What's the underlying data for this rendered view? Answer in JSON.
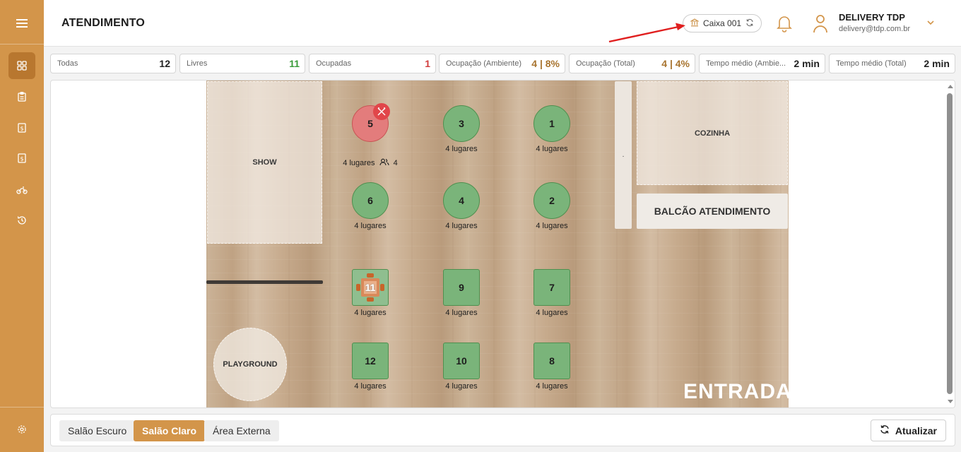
{
  "header": {
    "title": "ATENDIMENTO",
    "caixa_label": "Caixa 001",
    "user_name": "DELIVERY TDP",
    "user_email": "delivery@tdp.com.br"
  },
  "sidebar": {
    "items": [
      {
        "icon": "menu-icon"
      },
      {
        "icon": "grid-icon",
        "active": true
      },
      {
        "icon": "clipboard-icon"
      },
      {
        "icon": "cash-register-icon"
      },
      {
        "icon": "receipt-icon"
      },
      {
        "icon": "motorcycle-icon"
      },
      {
        "icon": "history-icon"
      },
      {
        "icon": "gear-icon"
      }
    ]
  },
  "stats": [
    {
      "label": "Todas",
      "value": "12",
      "color": "#222222"
    },
    {
      "label": "Livres",
      "value": "11",
      "color": "#3a9c3a"
    },
    {
      "label": "Ocupadas",
      "value": "1",
      "color": "#d13c3c"
    },
    {
      "label": "Ocupação (Ambiente)",
      "value": "4 | 8%",
      "color": "#a8742f"
    },
    {
      "label": "Ocupação (Total)",
      "value": "4 | 4%",
      "color": "#a8742f"
    },
    {
      "label": "Tempo médio (Ambie...",
      "value": "2 min",
      "color": "#222222"
    },
    {
      "label": "Tempo médio (Total)",
      "value": "2 min",
      "color": "#222222"
    }
  ],
  "floor": {
    "zones": {
      "show": "SHOW",
      "cozinha": "COZINHA",
      "balcao": "BALCÃO ATENDIMENTO",
      "playground": "PLAYGROUND",
      "entrada": "ENTRADA",
      "pillar_dot": "."
    },
    "tables": [
      {
        "number": "5",
        "seats": "4 lugares",
        "guests": "4",
        "status": "busy"
      },
      {
        "number": "3",
        "seats": "4 lugares",
        "status": "free"
      },
      {
        "number": "1",
        "seats": "4 lugares",
        "status": "free"
      },
      {
        "number": "6",
        "seats": "4 lugares",
        "status": "free"
      },
      {
        "number": "4",
        "seats": "4 lugares",
        "status": "free"
      },
      {
        "number": "2",
        "seats": "4 lugares",
        "status": "free"
      },
      {
        "number": "11",
        "seats": "4 lugares",
        "status": "special"
      },
      {
        "number": "9",
        "seats": "4 lugares",
        "status": "free"
      },
      {
        "number": "7",
        "seats": "4 lugares",
        "status": "free"
      },
      {
        "number": "12",
        "seats": "4 lugares",
        "status": "free"
      },
      {
        "number": "10",
        "seats": "4 lugares",
        "status": "free"
      },
      {
        "number": "8",
        "seats": "4 lugares",
        "status": "free"
      }
    ]
  },
  "bottom": {
    "tabs": [
      {
        "label": "Salão Escuro",
        "active": false
      },
      {
        "label": "Salão Claro",
        "active": true
      },
      {
        "label": "Área Externa",
        "active": false
      }
    ],
    "refresh_label": "Atualizar"
  }
}
